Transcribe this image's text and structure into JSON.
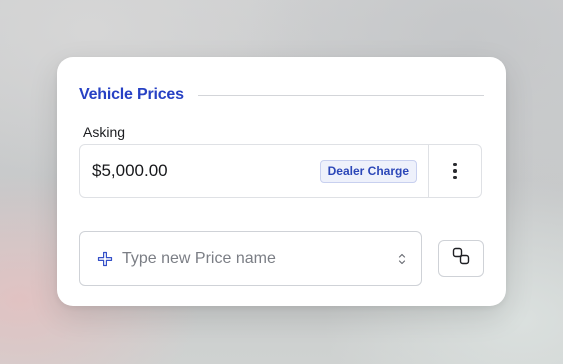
{
  "section": {
    "title": "Vehicle Prices"
  },
  "price_field": {
    "label": "Asking",
    "value": "$5,000.00",
    "badge": "Dealer Charge",
    "menu_icon": "more-vertical-icon"
  },
  "new_price": {
    "placeholder": "Type new Price name",
    "value": "",
    "leading_icon": "plus-icon",
    "trailing_icon": "chevron-up-down-icon"
  },
  "swap_button": {
    "icon": "swap-icon"
  },
  "colors": {
    "accent": "#2741c4",
    "badge_bg": "#eef1fb",
    "border": "#dfe1e5"
  }
}
